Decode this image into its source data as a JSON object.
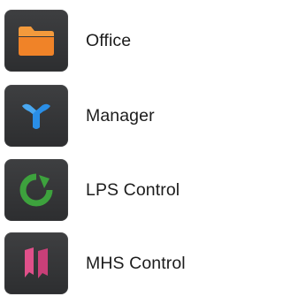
{
  "apps": [
    {
      "label": "Office",
      "icon": "folder-icon",
      "color": "#f28a2c"
    },
    {
      "label": "Manager",
      "icon": "y-branch-icon",
      "color": "#2d8fe0"
    },
    {
      "label": "LPS Control",
      "icon": "circular-arrow-icon",
      "color": "#3fa33f"
    },
    {
      "label": "MHS Control",
      "icon": "ribbon-bars-icon",
      "color": "#e0558a"
    }
  ]
}
